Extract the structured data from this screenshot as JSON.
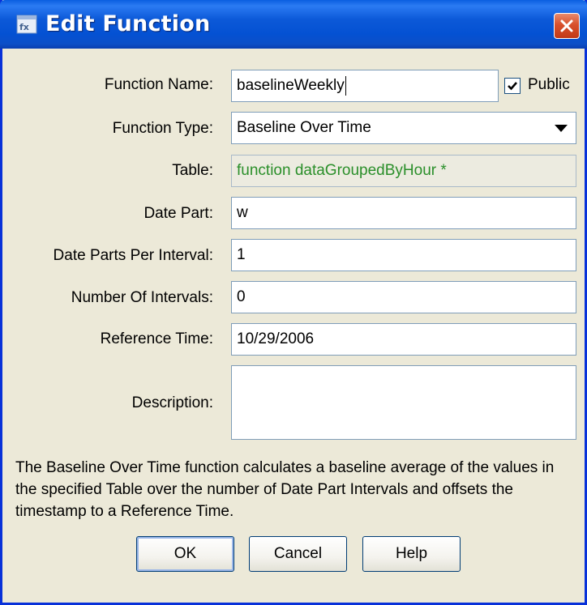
{
  "window": {
    "title": "Edit Function",
    "app_icon": "app-window-icon",
    "close_icon": "close-icon"
  },
  "form": {
    "function_name_label": "Function Name:",
    "function_name_value": "baselineWeekly",
    "public_label": "Public",
    "public_checked": true,
    "function_type_label": "Function Type:",
    "function_type_value": "Baseline Over Time",
    "table_label": "Table:",
    "table_value": "function dataGroupedByHour *",
    "date_part_label": "Date Part:",
    "date_part_value": "w",
    "date_parts_per_interval_label": "Date Parts Per Interval:",
    "date_parts_per_interval_value": "1",
    "number_of_intervals_label": "Number Of Intervals:",
    "number_of_intervals_value": "0",
    "reference_time_label": "Reference Time:",
    "reference_time_value": "10/29/2006",
    "description_label": "Description:",
    "description_value": ""
  },
  "help_text": "The Baseline Over Time function calculates a baseline average of the values in the specified Table over the number of Date Part Intervals and offsets the timestamp to a Reference Time.",
  "buttons": {
    "ok": "OK",
    "cancel": "Cancel",
    "help": "Help"
  },
  "colors": {
    "titlebar": "#0451d3",
    "dialog_bg": "#ece9d8",
    "table_text": "#2a8f2a",
    "close_button": "#d8502c"
  }
}
